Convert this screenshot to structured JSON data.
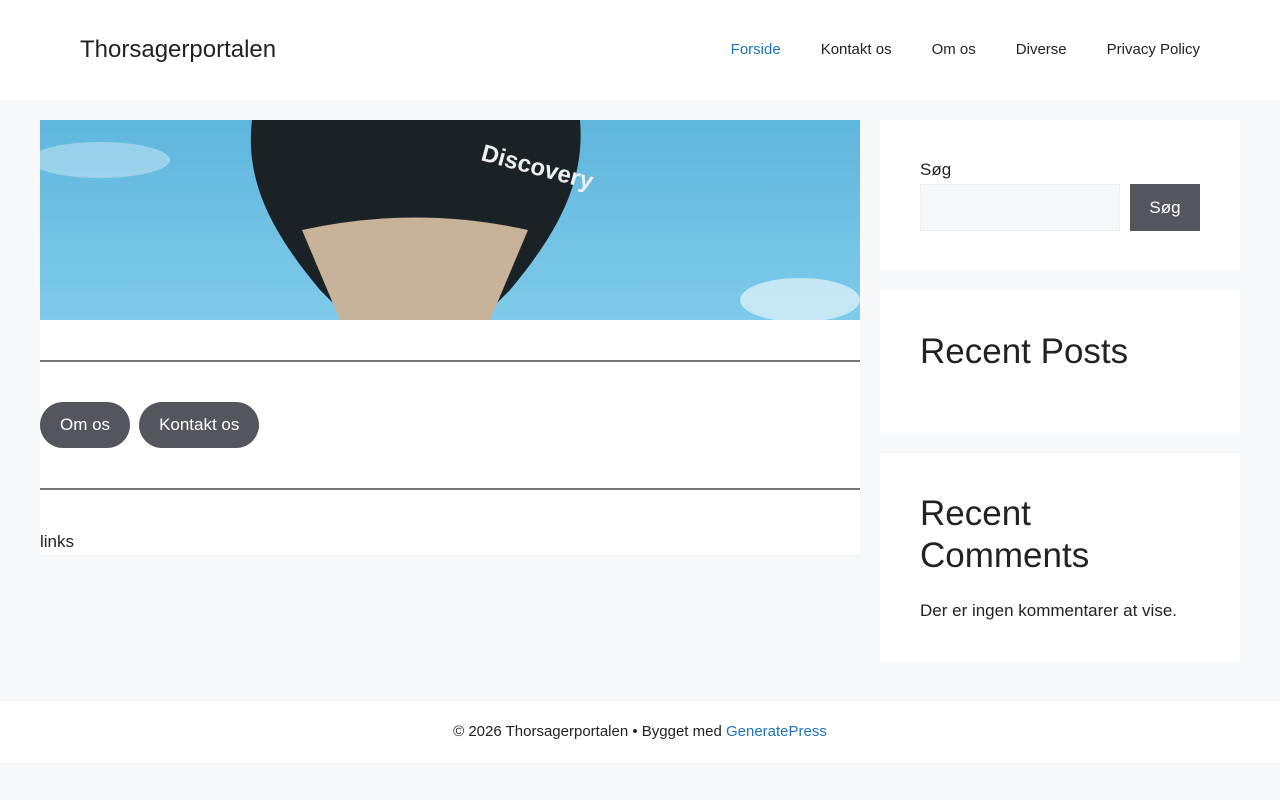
{
  "header": {
    "site_title": "Thorsagerportalen",
    "nav": [
      "Forside",
      "Kontakt os",
      "Om os",
      "Diverse",
      "Privacy Policy"
    ]
  },
  "main": {
    "buttons": [
      "Om os",
      "Kontakt os"
    ],
    "links_text": "links",
    "hero_text": "Discovery"
  },
  "sidebar": {
    "search_label": "Søg",
    "search_value": "",
    "search_button": "Søg",
    "recent_posts": "Recent Posts",
    "recent_comments": "Recent Comments",
    "no_comments": "Der er ingen kommentarer at vise."
  },
  "footer": {
    "text": "© 2026 Thorsagerportalen • Bygget med ",
    "link": "GeneratePress"
  }
}
